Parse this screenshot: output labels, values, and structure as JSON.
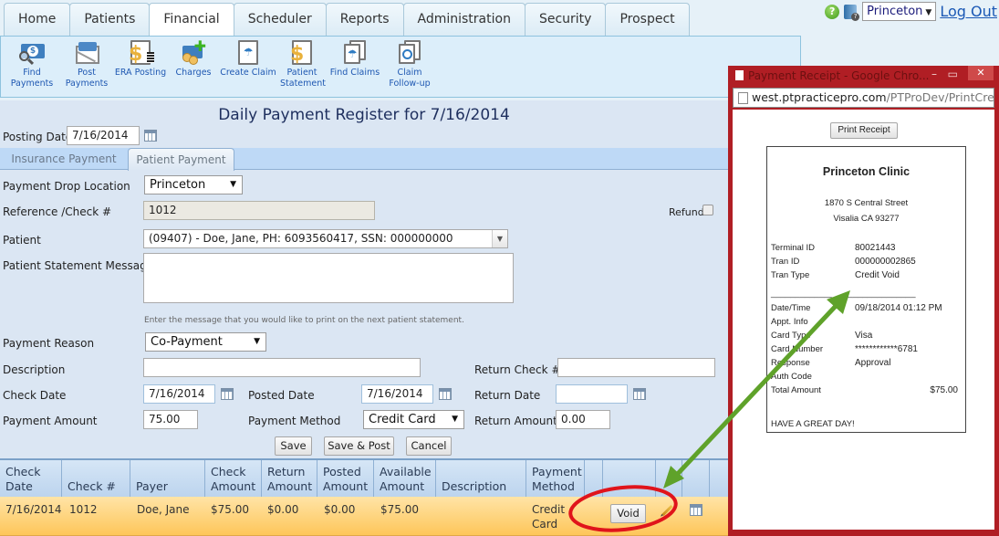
{
  "nav": {
    "tabs": [
      "Home",
      "Patients",
      "Financial",
      "Scheduler",
      "Reports",
      "Administration",
      "Security",
      "Prospect"
    ],
    "active": "Financial",
    "location": "Princeton",
    "logout": "Log Out"
  },
  "toolbar": {
    "items": [
      {
        "label1": "Find",
        "label2": "Payments",
        "icon": "find-payments-icon"
      },
      {
        "label1": "Post",
        "label2": "Payments",
        "icon": "post-payments-icon"
      },
      {
        "label1": "ERA Posting",
        "label2": "",
        "icon": "era-posting-icon"
      },
      {
        "label1": "Charges",
        "label2": "",
        "icon": "charges-icon"
      },
      {
        "label1": "Create Claim",
        "label2": "",
        "icon": "create-claim-icon"
      },
      {
        "label1": "Patient",
        "label2": "Statement",
        "icon": "patient-statement-icon"
      },
      {
        "label1": "Find Claims",
        "label2": "",
        "icon": "find-claims-icon"
      },
      {
        "label1": "Claim",
        "label2": "Follow-up",
        "icon": "claim-followup-icon"
      }
    ]
  },
  "page": {
    "title": "Daily Payment Register for 7/16/2014",
    "posting_date_label": "Posting Date",
    "posting_date": "7/16/2014",
    "tabs": [
      "Insurance Payment",
      "Patient Payment"
    ],
    "active_tab": "Patient Payment"
  },
  "form": {
    "drop_location_label": "Payment Drop Location",
    "drop_location": "Princeton",
    "reference_label": "Reference /Check #",
    "reference": "1012",
    "refund_label": "Refund",
    "refund_checked": false,
    "patient_label": "Patient",
    "patient": "(09407) - Doe, Jane, PH: 6093560417, SSN: 000000000",
    "statement_label": "Patient Statement Message",
    "statement_value": "",
    "statement_hint": "Enter the message that you would like to print on the next patient statement.",
    "reason_label": "Payment Reason",
    "reason": "Co-Payment",
    "description_label": "Description",
    "description": "",
    "return_check_label": "Return Check #",
    "return_check": "",
    "check_date_label": "Check Date",
    "check_date": "7/16/2014",
    "posted_date_label": "Posted Date",
    "posted_date": "7/16/2014",
    "return_date_label": "Return Date",
    "return_date": "",
    "amount_label": "Payment Amount",
    "amount": "75.00",
    "method_label": "Payment Method",
    "method": "Credit Card",
    "return_amount_label": "Return Amount",
    "return_amount": "0.00",
    "save": "Save",
    "save_post": "Save & Post",
    "cancel": "Cancel"
  },
  "grid": {
    "headers": [
      [
        "Check",
        "Date"
      ],
      [
        "",
        "Check #"
      ],
      [
        "",
        "Payer"
      ],
      [
        "Check",
        "Amount"
      ],
      [
        "Return",
        "Amount"
      ],
      [
        "Posted",
        "Amount"
      ],
      [
        "Available",
        "Amount"
      ],
      [
        "",
        "Description"
      ],
      [
        "Payment",
        "Method"
      ]
    ],
    "rows": [
      {
        "check_date": "7/16/2014",
        "check_no": "1012",
        "payer": "Doe, Jane",
        "check_amount": "$75.00",
        "return_amount": "$0.00",
        "posted_amount": "$0.00",
        "available_amount": "$75.00",
        "description": "",
        "method1": "Credit",
        "method2": "Card",
        "void": "Void"
      }
    ]
  },
  "popup": {
    "title": "Payment Receipt - Google Chro...",
    "url_host": "west.ptpracticepro.com",
    "url_path": "/PTProDev/PrintCredit(",
    "print_button": "Print Receipt",
    "receipt": {
      "clinic": "Princeton Clinic",
      "address1": "1870 S Central Street",
      "address2": "Visalia CA 93277",
      "fields": [
        {
          "label": "Terminal ID",
          "value": "80021443"
        },
        {
          "label": "Tran ID",
          "value": "000000002865"
        },
        {
          "label": "Tran Type",
          "value": "Credit Void"
        }
      ],
      "separator": "______________________________",
      "details": [
        {
          "label": "Date/Time",
          "value": "09/18/2014 01:12 PM"
        },
        {
          "label": "Appt. Info",
          "value": ""
        },
        {
          "label": "Card Type",
          "value": "Visa"
        },
        {
          "label": "Card Number",
          "value": "************6781"
        },
        {
          "label": "Response",
          "value": "Approval"
        },
        {
          "label": "Auth Code",
          "value": ""
        },
        {
          "label": "Total Amount",
          "value": "$75.00"
        }
      ],
      "footer": "HAVE A GREAT DAY!"
    }
  },
  "colors": {
    "popup_frame": "#b01e24",
    "row_highlight": "#fec65a",
    "annotation_arrow": "#5fa22a",
    "annotation_circle": "#e0141b"
  }
}
